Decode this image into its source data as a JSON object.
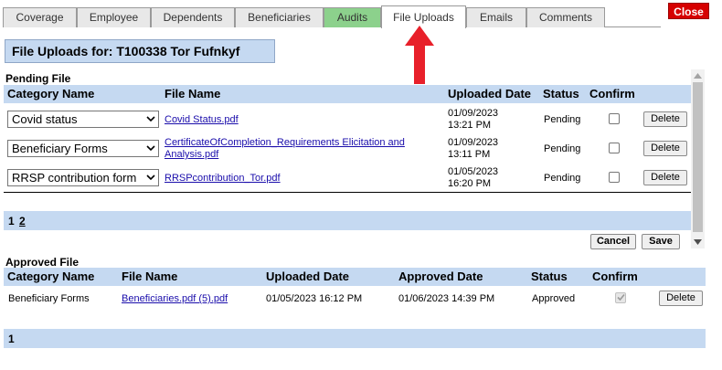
{
  "tabs": [
    {
      "label": "Coverage",
      "style": "normal"
    },
    {
      "label": "Employee",
      "style": "normal"
    },
    {
      "label": "Dependents",
      "style": "normal"
    },
    {
      "label": "Beneficiaries",
      "style": "normal"
    },
    {
      "label": "Audits",
      "style": "green"
    },
    {
      "label": "File Uploads",
      "style": "active"
    },
    {
      "label": "Emails",
      "style": "normal"
    },
    {
      "label": "Comments",
      "style": "normal"
    }
  ],
  "close_label": "Close",
  "title": "File Uploads for: T100338 Tor Fufnkyf",
  "pending": {
    "section_label": "Pending File",
    "headers": {
      "category": "Category Name",
      "file": "File Name",
      "uploaded": "Uploaded Date",
      "status": "Status",
      "confirm": "Confirm"
    },
    "rows": [
      {
        "category": "Covid status",
        "file": "Covid Status.pdf",
        "date": "01/09/2023",
        "time": "13:21 PM",
        "status": "Pending",
        "action": "Delete"
      },
      {
        "category": "Beneficiary Forms",
        "file_line1": "CertificateOfCompletion_Requirements Elicitation and",
        "file_line2": "Analysis.pdf",
        "date": "01/09/2023",
        "time": "13:11 PM",
        "status": "Pending",
        "action": "Delete"
      },
      {
        "category": "RRSP contribution form",
        "file": "RRSPcontribution_Tor.pdf",
        "date": "01/05/2023",
        "time": "16:20 PM",
        "status": "Pending",
        "action": "Delete"
      }
    ],
    "pager": {
      "page1": "1",
      "page2": "2"
    },
    "cancel_label": "Cancel",
    "save_label": "Save"
  },
  "approved": {
    "section_label": "Approved File",
    "headers": {
      "category": "Category Name",
      "file": "File Name",
      "uploaded": "Uploaded Date",
      "approved": "Approved Date",
      "status": "Status",
      "confirm": "Confirm"
    },
    "rows": [
      {
        "category": "Beneficiary Forms",
        "file": "Beneficiaries.pdf (5).pdf",
        "uploaded": "01/05/2023 16:12 PM",
        "approved": "01/06/2023 14:39 PM",
        "status": "Approved",
        "action": "Delete"
      }
    ],
    "pager": {
      "page1": "1"
    }
  },
  "colors": {
    "header_bg": "#c5d9f1",
    "close_bg": "#d60000",
    "audits_tab": "#8cd18c",
    "arrow": "#e8202a"
  }
}
